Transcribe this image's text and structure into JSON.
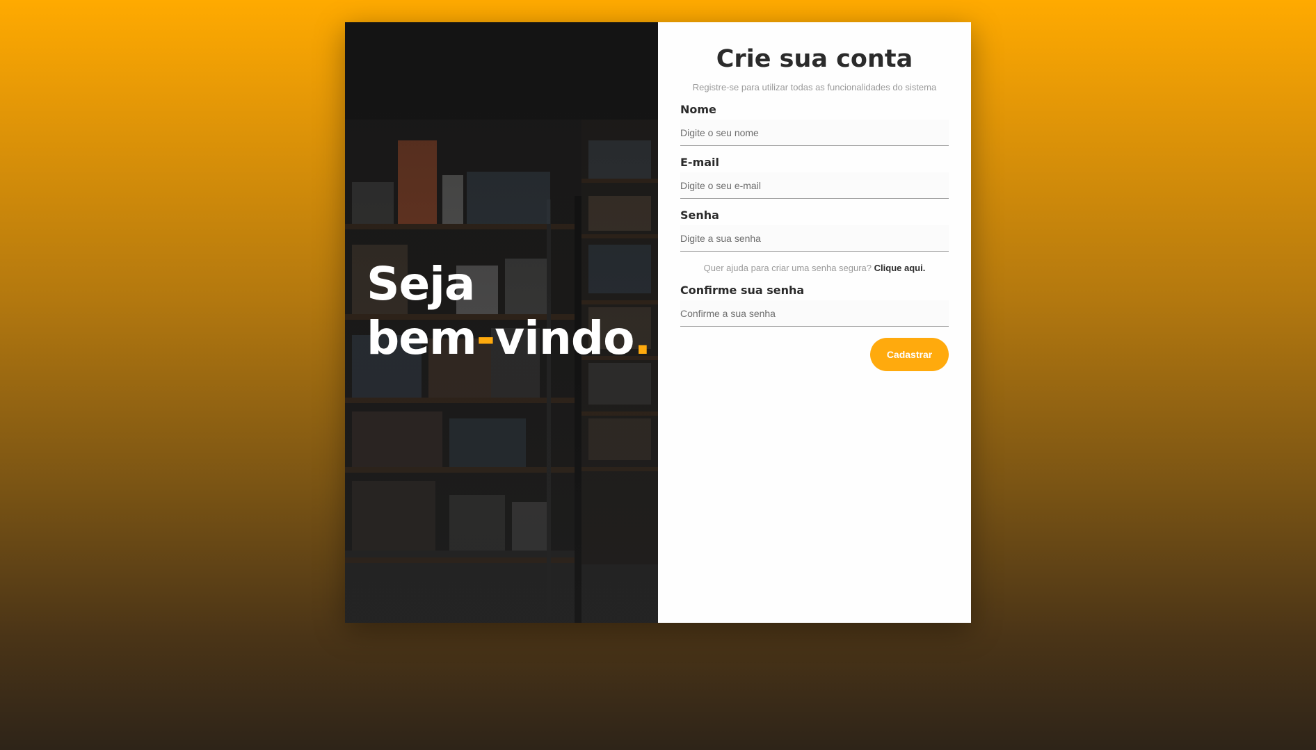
{
  "hero": {
    "welcome_line1": "Seja",
    "welcome_bem": "bem",
    "welcome_dash": "-",
    "welcome_vindo": "vindo",
    "welcome_dot": "."
  },
  "form": {
    "title": "Crie sua conta",
    "subtitle": "Registre-se para utilizar todas as funcionalidades do sistema",
    "fields": [
      {
        "label": "Nome",
        "placeholder": "Digite o seu nome"
      },
      {
        "label": "E-mail",
        "placeholder": "Digite o seu e-mail"
      },
      {
        "label": "Senha",
        "placeholder": "Digite a sua senha"
      },
      {
        "label": "Confirme sua senha",
        "placeholder": "Confirme a sua senha"
      }
    ],
    "help_text": "Quer ajuda para criar uma senha segura?",
    "help_link": "Clique aqui.",
    "submit_label": "Cadastrar"
  },
  "colors": {
    "accent": "#ffaa0d",
    "background_top": "#ffaa00",
    "background_bottom": "#2e2418",
    "text_dark": "#2b2b2b"
  }
}
